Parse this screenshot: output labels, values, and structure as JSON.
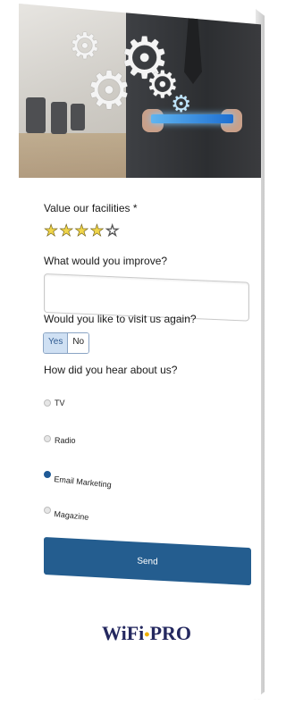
{
  "form": {
    "rating_label": "Value our facilities *",
    "rating": {
      "value": 4,
      "max": 5,
      "filled_color": "#f0d54a"
    },
    "improve_label": "What would you improve?",
    "improve_value": "",
    "visit_again_label": "Would you like to visit us again?",
    "visit_options": [
      "Yes",
      "No"
    ],
    "visit_selected": "Yes",
    "hear_label": "How did you hear about us?",
    "hear_options": [
      "TV",
      "Radio",
      "Email Marketing",
      "Magazine"
    ],
    "hear_selected": "Email Marketing",
    "submit_label": "Send",
    "accent_color": "#245d8f"
  },
  "brand": {
    "logo_text_left": "WiFi",
    "logo_dot": "•",
    "logo_text_right": "PRO"
  },
  "hero": {
    "icons": [
      "gear-icon",
      "tablet-icon"
    ]
  },
  "star_icons": {
    "filled": "★",
    "empty": "☆"
  }
}
